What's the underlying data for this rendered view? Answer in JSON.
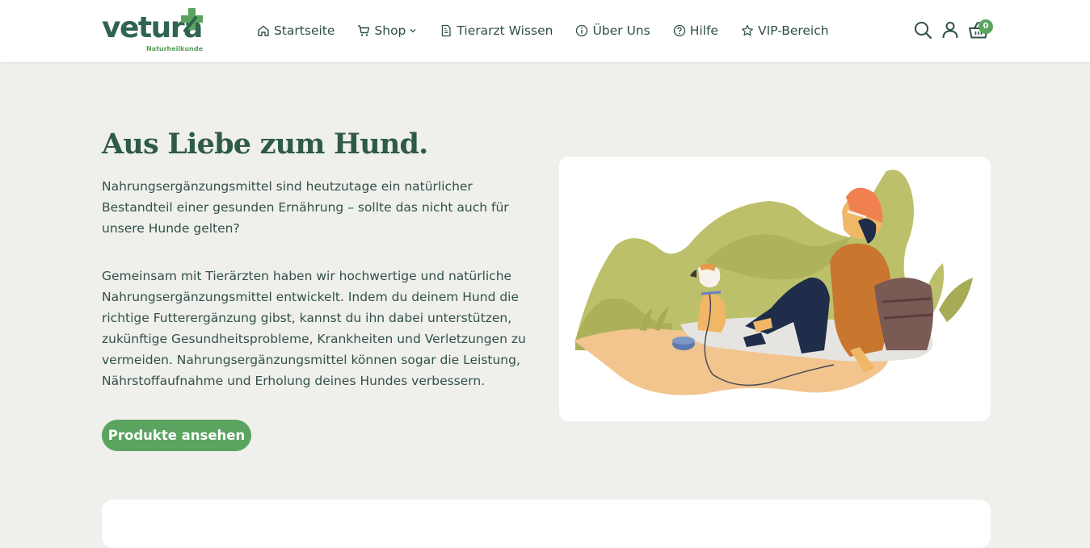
{
  "brand": {
    "name": "vetura",
    "tagline": "Naturheilkunde"
  },
  "nav": {
    "items": [
      {
        "label": "Startseite",
        "icon": "home-icon"
      },
      {
        "label": "Shop",
        "icon": "cart-icon",
        "has_dropdown": true
      },
      {
        "label": "Tierarzt Wissen",
        "icon": "document-icon"
      },
      {
        "label": "Über Uns",
        "icon": "info-icon"
      },
      {
        "label": "Hilfe",
        "icon": "help-icon"
      },
      {
        "label": "VIP-Bereich",
        "icon": "star-icon"
      }
    ]
  },
  "header_actions": {
    "search_icon": "search-icon",
    "account_icon": "user-icon",
    "cart_icon": "basket-icon",
    "cart_count": "0"
  },
  "hero": {
    "title": "Aus Liebe zum Hund.",
    "paragraph_1": "Nahrungsergänzungsmittel sind heutzutage ein natürlicher Bestandteil einer gesunden Ernährung – sollte das nicht auch für unsere Hunde gelten?",
    "paragraph_2": "Gemeinsam mit Tierärzten haben wir hochwertige und natürliche Nahrungsergänzungsmittel entwickelt. Indem du deinem Hund die richtige Futterergänzung gibst, kannst du ihn dabei unterstützen, zukünftige Gesundheitsprobleme, Krankheiten und Verletzungen zu vermeiden. Nahrungsergänzungsmittel können sogar die Leistung, Nährstoffaufnahme und Erholung deines Hundes verbessern.",
    "cta_label": "Produkte ansehen"
  },
  "colors": {
    "brand_dark_green": "#2f6450",
    "accent_green": "#5aa460",
    "page_background": "#eff0eb"
  }
}
